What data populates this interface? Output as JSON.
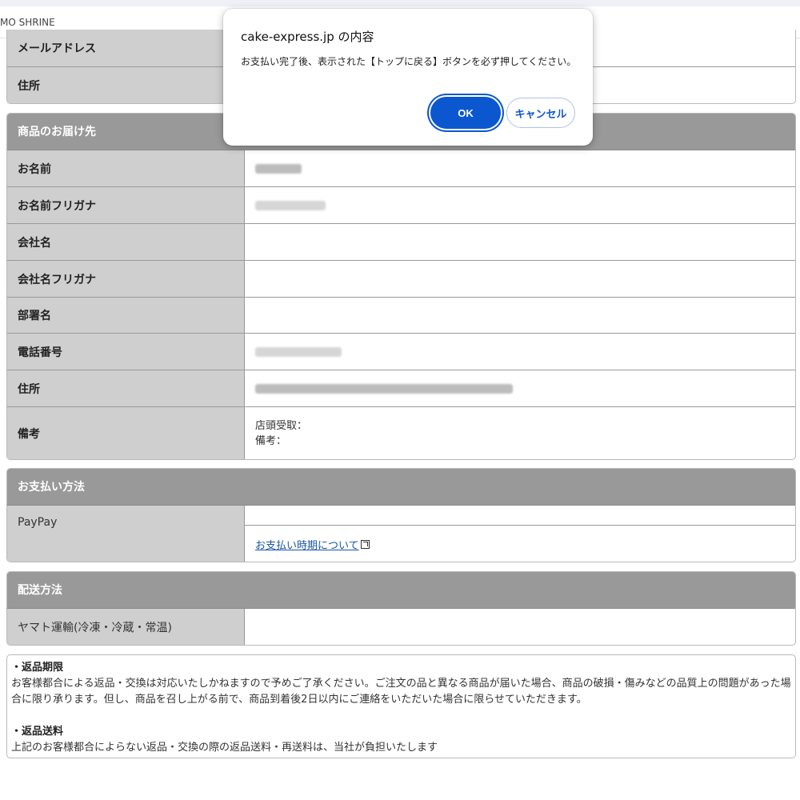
{
  "browser": {
    "site_label": "MO SHRINE"
  },
  "dialog": {
    "title": "cake-express.jp の内容",
    "message": "お支払い完了後、表示された【トップに戻る】ボタンを必ず押してください。",
    "ok_label": "OK",
    "cancel_label": "キャンセル"
  },
  "customer_partial": {
    "rows": [
      {
        "label": "メールアドレス"
      },
      {
        "label": "住所"
      }
    ]
  },
  "delivery": {
    "heading": "商品のお届け先",
    "rows": [
      {
        "label": "お名前"
      },
      {
        "label": "お名前フリガナ"
      },
      {
        "label": "会社名"
      },
      {
        "label": "会社名フリガナ"
      },
      {
        "label": "部署名"
      },
      {
        "label": "電話番号"
      },
      {
        "label": "住所"
      },
      {
        "label": "備考",
        "lines": [
          "店頭受取：",
          "備考："
        ]
      }
    ]
  },
  "payment": {
    "heading": "お支払い方法",
    "method": "PayPay",
    "link_text": "お支払い時期について"
  },
  "shipping": {
    "heading": "配送方法",
    "method": "ヤマト運輸(冷凍・冷蔵・常温)"
  },
  "returns": {
    "title1": "・返品期限",
    "text1": "お客様都合による返品・交換は対応いたしかねますので予めご了承ください。ご注文の品と異なる商品が届いた場合、商品の破損・傷みなどの品質上の問題があった場合に限り承ります。但し、商品を召し上がる前で、商品到着後2日以内にご連絡をいただいた場合に限らせていただきます。",
    "title2": "・返品送料",
    "text2": "上記のお客様都合によらない返品・交換の際の返品送料・再送料は、当社が負担いたします"
  }
}
